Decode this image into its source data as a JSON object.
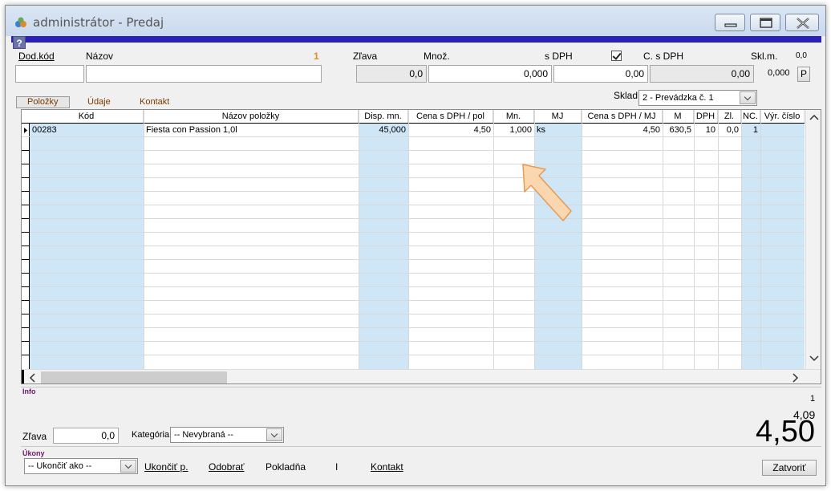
{
  "window": {
    "title": "administrátor - Predaj"
  },
  "header_form": {
    "help_label": "?",
    "dod_kod_label": "Dod.kód",
    "nazov_label": "Názov",
    "badge_number": "1",
    "zlava_label": "Zľava",
    "zlava_value": "0,0",
    "mnoz_label": "Množ.",
    "mnoz_value": "0,000",
    "s_dph_label": "s DPH",
    "s_dph_value": "0,00",
    "c_s_dph_label": "C. s DPH",
    "c_s_dph_value": "0,00",
    "skl_m_label": "Skl.m.",
    "skl_m_value_top": "0,0",
    "skl_m_value": "0,000",
    "p_button": "P"
  },
  "tabs": [
    {
      "label": "Položky",
      "active": true
    },
    {
      "label": "Údaje",
      "active": false
    },
    {
      "label": "Kontakt",
      "active": false
    }
  ],
  "sklad": {
    "label": "Sklad",
    "value": "2 - Prevádzka č. 1"
  },
  "grid": {
    "columns": [
      "Kód",
      "Názov položky",
      "Disp. mn.",
      "Cena s DPH / pol",
      "Mn.",
      "MJ",
      "Cena s DPH / MJ",
      "M",
      "DPH",
      "Zl.",
      "NC.",
      "Výr. číslo"
    ],
    "rows": [
      {
        "kod": "00283",
        "nazov": "Fiesta con Passion 1,0l",
        "disp_mn": "45,000",
        "cena_pol": "4,50",
        "mn": "1,000",
        "mj": "ks",
        "cena_mj": "4,50",
        "m": "630,5",
        "dph": "10",
        "zl": "0,0",
        "nc": "1",
        "vyr_cislo": ""
      }
    ]
  },
  "info": {
    "label": "Info",
    "count": "1",
    "subtotal": "4,09",
    "total": "4,50",
    "zlava_label": "Zľava",
    "zlava_value": "0,0",
    "kategoria_label": "Kategória",
    "kategoria_value": "-- Nevybraná --"
  },
  "ukony": {
    "label": "Úkony",
    "ukoncit_ako": "-- Ukončiť ako --",
    "ukoncit_p": "Ukončiť p.",
    "odobrat": "Odobrať",
    "pokladna": "Pokladňa",
    "separator": "I",
    "kontakt": "Kontakt",
    "zatvorit": "Zatvoriť"
  }
}
